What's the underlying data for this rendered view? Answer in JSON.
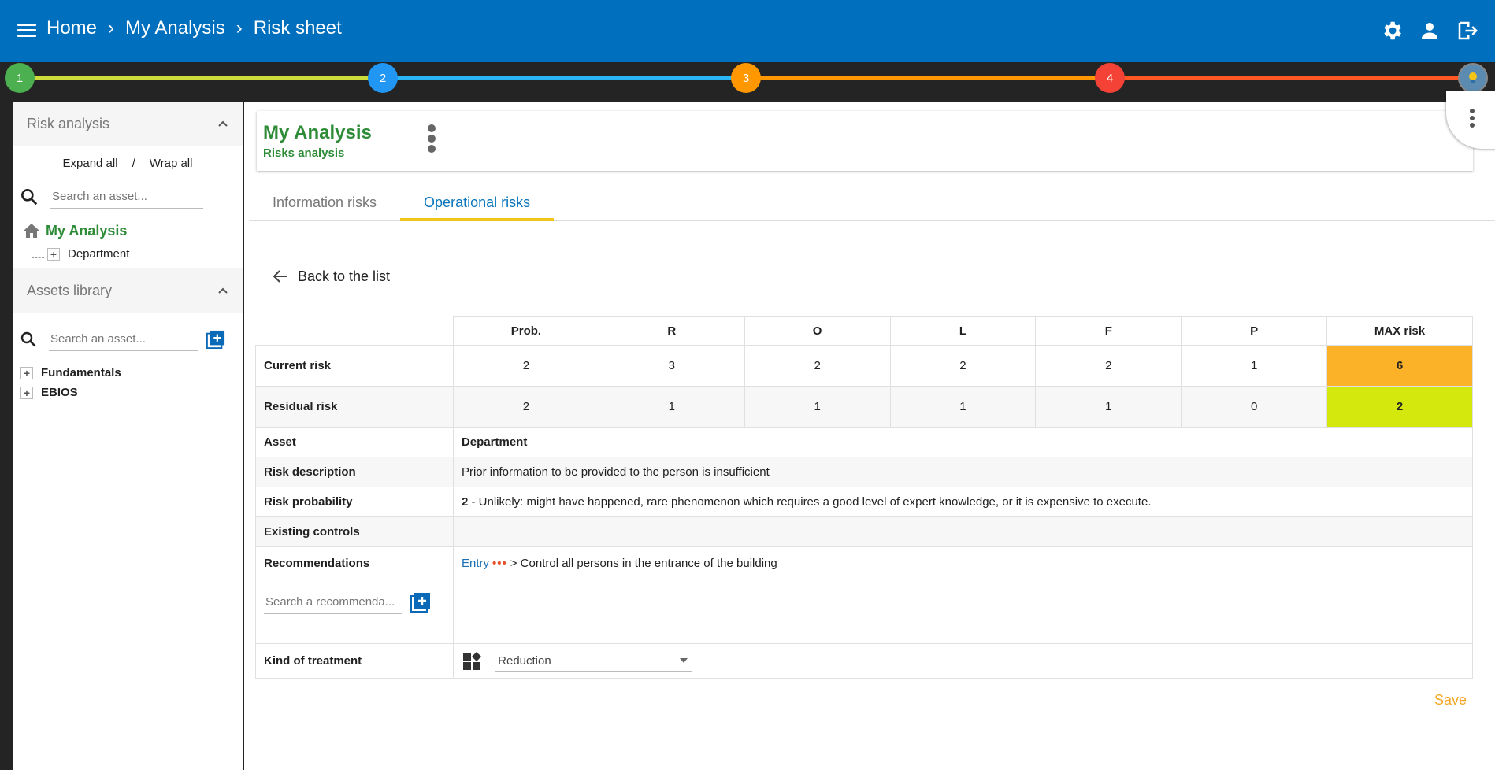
{
  "breadcrumb": [
    "Home",
    "My Analysis",
    "Risk sheet"
  ],
  "stepper": {
    "steps": [
      "1",
      "2",
      "3",
      "4"
    ],
    "colors": [
      "#4caf50",
      "#2196f3",
      "#ff9800",
      "#f44336"
    ],
    "segment_colors": [
      "#cddc39",
      "#29b6f6",
      "#ff9800",
      "#ff5722"
    ]
  },
  "sidebar": {
    "risk_title": "Risk analysis",
    "expand_all": "Expand all",
    "separator": "/",
    "wrap_all": "Wrap all",
    "search_placeholder": "Search an asset...",
    "root_label": "My Analysis",
    "child_label": "Department",
    "library_title": "Assets library",
    "library_search_placeholder": "Search an asset...",
    "library_items": [
      "Fundamentals",
      "EBIOS"
    ]
  },
  "analysis": {
    "title": "My Analysis",
    "subtitle": "Risks analysis"
  },
  "tabs": [
    "Information risks",
    "Operational risks"
  ],
  "back_label": "Back to the list",
  "table": {
    "headers": [
      "Prob.",
      "R",
      "O",
      "L",
      "F",
      "P",
      "MAX risk"
    ],
    "rows": [
      {
        "label": "Current risk",
        "values": [
          "2",
          "3",
          "2",
          "2",
          "2",
          "1"
        ],
        "max": "6",
        "max_color": "#fbb128"
      },
      {
        "label": "Residual risk",
        "values": [
          "2",
          "1",
          "1",
          "1",
          "1",
          "0"
        ],
        "max": "2",
        "max_color": "#d4e80e"
      }
    ],
    "asset_label": "Asset",
    "asset_value": "Department",
    "desc_label": "Risk description",
    "desc_value": "Prior information to be provided to the person is insufficient",
    "prob_label": "Risk probability",
    "prob_num": "2",
    "prob_text": " - Unlikely: might have happened, rare phenomenon which requires a good level of expert knowledge, or it is expensive to execute.",
    "controls_label": "Existing controls",
    "rec_label": "Recommendations",
    "rec_search_placeholder": "Search a recommenda...",
    "rec_link": "Entry",
    "rec_dots": "•••",
    "rec_text": "> Control all persons in the entrance of the building",
    "treatment_label": "Kind of treatment",
    "treatment_value": "Reduction"
  },
  "save_label": "Save"
}
